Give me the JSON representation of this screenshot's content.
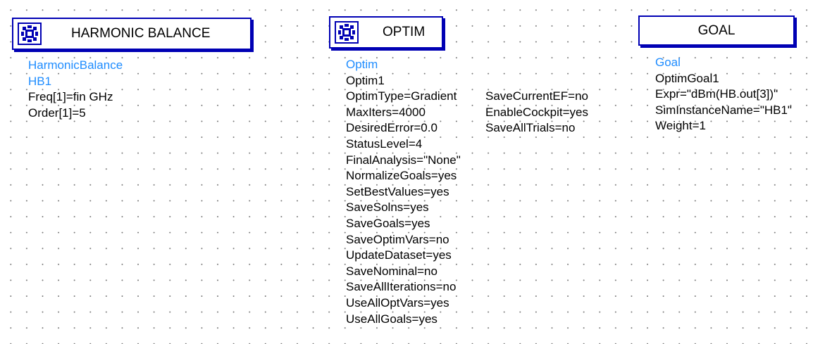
{
  "harmonic_balance": {
    "title": "HARMONIC BALANCE",
    "type_label": "HarmonicBalance",
    "instance": "HB1",
    "params": [
      "Freq[1]=fin GHz",
      "Order[1]=5"
    ]
  },
  "optim": {
    "title": "OPTIM",
    "type_label": "Optim",
    "instance": "Optim1",
    "params_col1": [
      "OptimType=Gradient",
      "MaxIters=4000",
      "DesiredError=0.0",
      "StatusLevel=4",
      "FinalAnalysis=\"None\"",
      "NormalizeGoals=yes",
      "SetBestValues=yes",
      "SaveSolns=yes",
      "SaveGoals=yes",
      "SaveOptimVars=no",
      "UpdateDataset=yes",
      "SaveNominal=no",
      "SaveAllIterations=no",
      "UseAllOptVars=yes",
      "UseAllGoals=yes"
    ],
    "params_col2": [
      "SaveCurrentEF=no",
      "EnableCockpit=yes",
      "SaveAllTrials=no"
    ]
  },
  "goal": {
    "title": "GOAL",
    "type_label": "Goal",
    "instance": "OptimGoal1",
    "params": [
      "Expr=\"dBm(HB.out[3])\"",
      "SimInstanceName=\"HB1\"",
      "Weight=1"
    ]
  },
  "colors": {
    "component_border": "#0000b4",
    "label_blue": "#1e8cff",
    "grid_dot": "#7a7a7a"
  },
  "icons": {
    "simulation": "simulation-controller-icon"
  }
}
